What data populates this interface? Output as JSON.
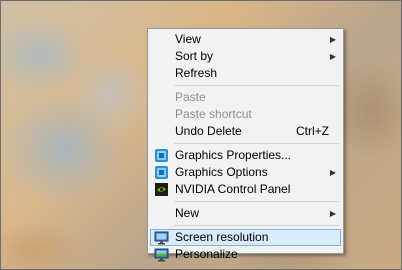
{
  "context_menu": {
    "items": [
      {
        "label": "View",
        "submenu": true
      },
      {
        "label": "Sort by",
        "submenu": true
      },
      {
        "label": "Refresh"
      },
      {
        "label": "Paste",
        "disabled": true
      },
      {
        "label": "Paste shortcut",
        "disabled": true
      },
      {
        "label": "Undo Delete",
        "shortcut": "Ctrl+Z"
      },
      {
        "label": "Graphics Properties...",
        "icon": "intel-graphics-icon"
      },
      {
        "label": "Graphics Options",
        "icon": "intel-graphics-icon",
        "submenu": true
      },
      {
        "label": "NVIDIA Control Panel",
        "icon": "nvidia-icon"
      },
      {
        "label": "New",
        "submenu": true
      },
      {
        "label": "Screen resolution",
        "icon": "monitor-icon",
        "highlighted": true
      },
      {
        "label": "Personalize",
        "icon": "personalize-icon"
      }
    ]
  },
  "colors": {
    "menu_background": "#f2f2f2",
    "highlight_background": "#d9ebf9",
    "highlight_border": "#7eb4ea",
    "disabled_text": "#8d8d8d"
  }
}
